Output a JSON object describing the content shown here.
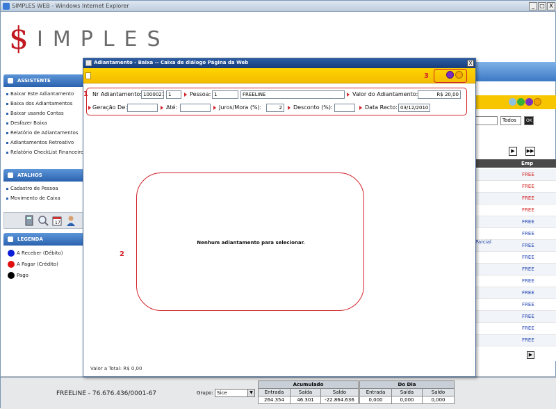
{
  "window": {
    "title": "SIMPLES WEB - Windows Internet Explorer",
    "controls": [
      "_",
      "□",
      "X"
    ]
  },
  "logo": {
    "dollar": "$",
    "text": "IMPLES"
  },
  "sidebar": {
    "assistente": {
      "title": "ASSISTENTE",
      "items": [
        "Baixar Este Adiantamento",
        "Baixa dos Adiantamentos",
        "Baixar usando Contas",
        "Desfazer Baixa",
        "Relatório de Adiantamentos",
        "Adiantamentos Retroativo",
        "Relatório CheckList Financeiro"
      ]
    },
    "atalhos": {
      "title": "ATALHOS",
      "items": [
        "Cadastro de Pessoa",
        "Movimento de Caixa"
      ]
    },
    "legenda": {
      "title": "LEGENDA",
      "items": [
        {
          "label": "A Receber (Débito)",
          "color": "#0a1ed8"
        },
        {
          "label": "A Pagar (Crédito)",
          "color": "#e01010"
        },
        {
          "label": "Pago",
          "color": "#000000"
        }
      ]
    }
  },
  "background": {
    "filter_select": "",
    "todos_select": "Todos",
    "ok_button": "OK",
    "grid_header": "Emp",
    "grid_rows": [
      "FREE",
      "FREE",
      "FREE",
      "FREE",
      "FREE",
      "FREE",
      "FREE",
      "FREE",
      "FREE",
      "FREE",
      "FREE",
      "FREE",
      "FREE",
      "FREE",
      "FREE"
    ],
    "parcial_text": "Parcial",
    "nav_next": "▶",
    "nav_last": "▶▶",
    "scroll_btn": "▶"
  },
  "dialog": {
    "title": "Adiantamento - Baixa -- Caixa de diálogo Página da Web",
    "close": "X",
    "annotations": {
      "one": "1",
      "two": "2",
      "three": "3"
    },
    "form": {
      "nr_label": "Nr Adiantamento:",
      "nr_value": "1000027",
      "nr_seq": "1",
      "pessoa_label": "Pessoa:",
      "pessoa_code": "1",
      "pessoa_name": "FREELINE",
      "valor_label": "Valor do Adiantamento:",
      "valor_value": "R$ 20,00",
      "geracao_label": "Geração De:",
      "geracao_value": "",
      "ate_label": "Até:",
      "ate_value": "",
      "juros_label": "Juros/Mora (%):",
      "juros_value": "2",
      "desconto_label": "Desconto (%):",
      "desconto_value": "",
      "data_label": "Data Recto:",
      "data_value": "03/12/2010"
    },
    "empty_message": "Nenhum adiantamento para selecionar.",
    "total_label": "Valor a Total: R$ 0,00"
  },
  "footer": {
    "company": "FREELINE - 76.676.436/0001-67",
    "grupo_label": "Grupo:",
    "grupo_value": "Sice",
    "acumulado": {
      "title": "Acumulado",
      "cols": [
        "Entrada",
        "Saída",
        "Saldo"
      ],
      "values": [
        "264.354",
        "46.301",
        "-22.864.636"
      ]
    },
    "do_dia": {
      "title": "Do Dia",
      "cols": [
        "Entrada",
        "Saída",
        "Saldo"
      ],
      "values": [
        "0,000",
        "0,000",
        "0,000"
      ]
    }
  }
}
